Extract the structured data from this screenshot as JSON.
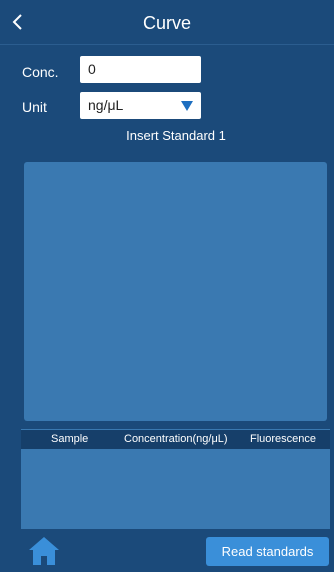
{
  "header": {
    "title": "Curve",
    "back_icon": "chevron-left-icon"
  },
  "form": {
    "conc_label": "Conc.",
    "conc_value": "0",
    "unit_label": "Unit",
    "unit_value": "ng/μL"
  },
  "instruction": "Insert Standard 1",
  "table": {
    "columns": [
      "Sample",
      "Concentration(ng/μL)",
      "Fluorescence"
    ],
    "rows": []
  },
  "footer": {
    "home_icon": "home-icon",
    "read_button_label": "Read standards"
  },
  "colors": {
    "background": "#1b4a7a",
    "panel": "#3a79b1",
    "button": "#3a8fd9"
  }
}
